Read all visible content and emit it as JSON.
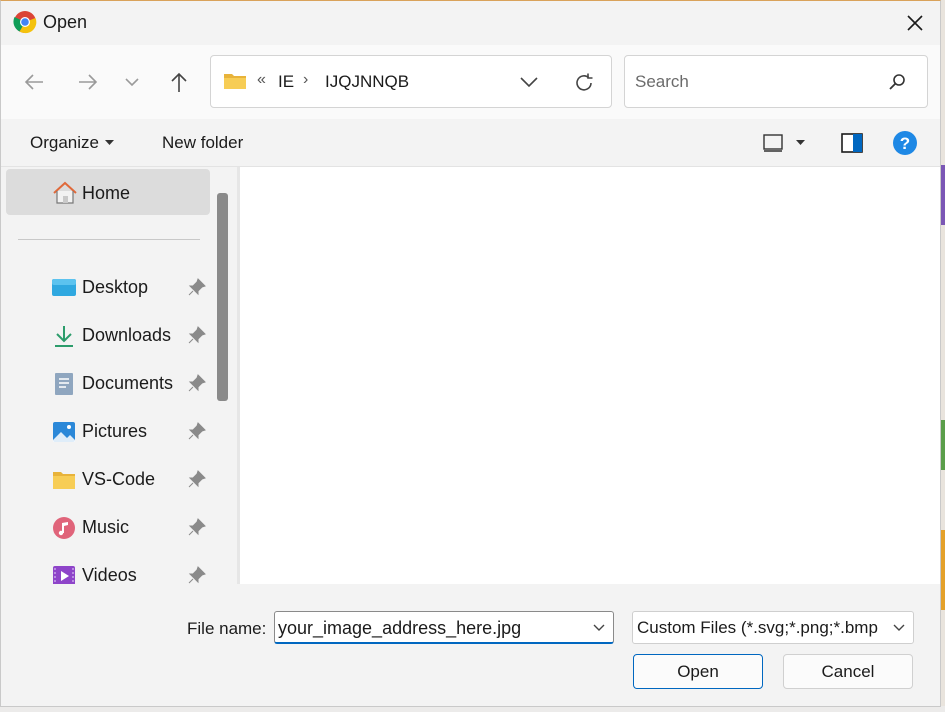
{
  "window": {
    "title": "Open"
  },
  "address": {
    "overflow_glyph": "«",
    "breadcrumbs": [
      "IE",
      "IJQJNNQB"
    ]
  },
  "search": {
    "placeholder": "Search"
  },
  "toolbar": {
    "organize_label": "Organize",
    "new_folder_label": "New folder"
  },
  "navpane": {
    "home_label": "Home",
    "items": [
      {
        "label": "Desktop",
        "icon": "desktop-icon",
        "pinned": true
      },
      {
        "label": "Downloads",
        "icon": "downloads-icon",
        "pinned": true
      },
      {
        "label": "Documents",
        "icon": "documents-icon",
        "pinned": true
      },
      {
        "label": "Pictures",
        "icon": "pictures-icon",
        "pinned": true
      },
      {
        "label": "VS-Code",
        "icon": "folder-icon",
        "pinned": true
      },
      {
        "label": "Music",
        "icon": "music-icon",
        "pinned": true
      },
      {
        "label": "Videos",
        "icon": "videos-icon",
        "pinned": true
      }
    ]
  },
  "footer": {
    "filename_label": "File name:",
    "filename_value": "your_image_address_here.jpg",
    "filetype_value": "Custom Files (*.svg;*.png;*.bmp",
    "open_label": "Open",
    "cancel_label": "Cancel"
  },
  "colors": {
    "accent": "#0067c0",
    "help_blue": "#1e88e5",
    "folder_yellow": "#f2c94c"
  }
}
